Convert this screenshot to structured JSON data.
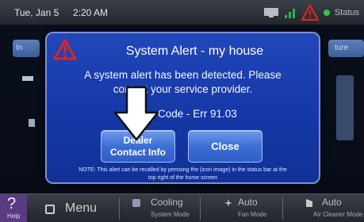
{
  "statusbar": {
    "date": "Tue, Jan 5",
    "time": "2:20 AM",
    "status_label": "Status",
    "icons": [
      "tv-icon",
      "signal-icon",
      "alert-icon",
      "status-dot-icon"
    ]
  },
  "background": {
    "left_tab": "In",
    "right_tab": "ture"
  },
  "dialog": {
    "title": "System Alert - my house",
    "message_line1": "A system alert has been detected. Please",
    "message_line2": "contact your service provider.",
    "code": "Code - Err 91.03",
    "dealer_button_line1": "Dealer",
    "dealer_button_line2": "Contact Info",
    "close_button": "Close",
    "note_line1": "NOTE: This alert can be recalled by pressing the (icon image) in the status bar at the",
    "note_line2": "top right of the home screen"
  },
  "bottombar": {
    "help_label": "Help",
    "help_glyph": "?",
    "menu_label": "Menu",
    "cooling_main": "Cooling",
    "cooling_sub": "System Mode",
    "fan_main": "Auto",
    "fan_sub": "Fan Mode",
    "air_main": "Auto",
    "air_sub": "Air Cleaner Mode"
  },
  "colors": {
    "dialog_bg": "#1a40b0",
    "button_bg": "#3c6fd6",
    "alert_red": "#e0241d",
    "status_green": "#37c24a",
    "help_purple": "#5a3b82"
  }
}
